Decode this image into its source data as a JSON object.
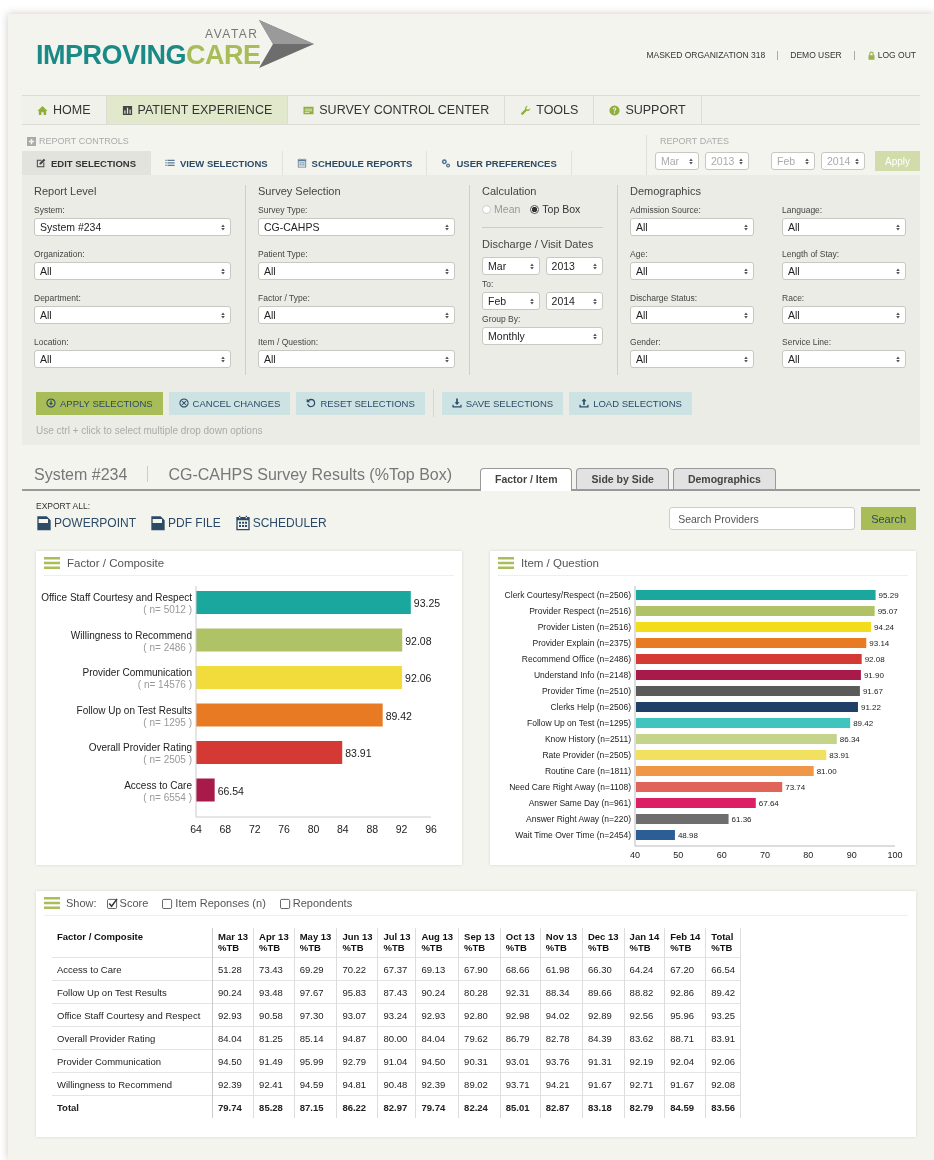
{
  "header": {
    "logo": {
      "small": "AVATAR",
      "main_1": "IMPROVING",
      "main_2": "CARE"
    },
    "top_links": [
      {
        "label": "MASKED ORGANIZATION 318",
        "kind": "text"
      },
      {
        "label": "DEMO USER",
        "kind": "text"
      },
      {
        "label": "LOG OUT",
        "kind": "logout"
      }
    ]
  },
  "nav": [
    {
      "label": "HOME",
      "kind": "home",
      "selected": false
    },
    {
      "label": "PATIENT EXPERIENCE",
      "kind": "chart",
      "selected": true
    },
    {
      "label": "SURVEY CONTROL CENTER",
      "kind": "card",
      "selected": false
    },
    {
      "label": "TOOLS",
      "kind": "wrench",
      "selected": false
    },
    {
      "label": "SUPPORT",
      "kind": "help",
      "selected": false
    }
  ],
  "report_controls": {
    "title": "REPORT CONTROLS",
    "tabs": [
      {
        "label": "EDIT SELECTIONS",
        "kind": "edit",
        "selected": true
      },
      {
        "label": "VIEW SELECTIONS",
        "kind": "list",
        "selected": false
      },
      {
        "label": "SCHEDULE REPORTS",
        "kind": "calendar",
        "selected": false
      },
      {
        "label": "USER PREFERENCES",
        "kind": "gears",
        "selected": false
      }
    ]
  },
  "report_dates": {
    "title": "REPORT DATES",
    "disabled": true,
    "fields": [
      "Mar",
      "2013",
      "Feb",
      "2014"
    ],
    "apply": "Apply"
  },
  "report_level": {
    "title": "Report Level",
    "fields": [
      {
        "label": "System:",
        "value": "System #234"
      },
      {
        "label": "Organization:",
        "value": "All"
      },
      {
        "label": "Department:",
        "value": "All"
      },
      {
        "label": "Location:",
        "value": "All"
      }
    ]
  },
  "survey_selection": {
    "title": "Survey Selection",
    "fields": [
      {
        "label": "Survey Type:",
        "value": "CG-CAHPS"
      },
      {
        "label": "Patient Type:",
        "value": "All"
      },
      {
        "label": "Factor / Type:",
        "value": "All"
      },
      {
        "label": "Item / Question:",
        "value": "All"
      }
    ]
  },
  "calculation": {
    "title": "Calculation",
    "options": [
      {
        "label": "Mean",
        "selected": false,
        "disabled": true
      },
      {
        "label": "Top Box",
        "selected": true,
        "disabled": false
      }
    ],
    "dates_title": "Discharge / Visit Dates",
    "from": [
      "Mar",
      "2013"
    ],
    "to_label": "To:",
    "to": [
      "Feb",
      "2014"
    ],
    "group_by": {
      "label": "Group By:",
      "value": "Monthly"
    }
  },
  "demographics": {
    "title": "Demographics",
    "fields": [
      {
        "label": "Admission Source:",
        "value": "All"
      },
      {
        "label": "Language:",
        "value": "All"
      },
      {
        "label": "Age:",
        "value": "All"
      },
      {
        "label": "Length of Stay:",
        "value": "All"
      },
      {
        "label": "Discharge Status:",
        "value": "All"
      },
      {
        "label": "Race:",
        "value": "All"
      },
      {
        "label": "Gender:",
        "value": "All"
      },
      {
        "label": "Service Line:",
        "value": "All"
      }
    ]
  },
  "actions": [
    {
      "label": "APPLY SELECTIONS",
      "kind": "apply"
    },
    {
      "label": "CANCEL CHANGES",
      "kind": "cancel"
    },
    {
      "label": "RESET SELECTIONS",
      "kind": "reset"
    },
    {
      "label": "SAVE SELECTIONS",
      "kind": "save"
    },
    {
      "label": "LOAD SELECTIONS",
      "kind": "load"
    }
  ],
  "hint": "Use ctrl + click to select multiple drop down options",
  "results": {
    "system": "System #234",
    "title": "CG-CAHPS Survey Results (%Top Box)",
    "tabs": [
      {
        "label": "Factor / Item",
        "selected": true
      },
      {
        "label": "Side by Side",
        "selected": false
      },
      {
        "label": "Demographics",
        "selected": false
      }
    ]
  },
  "export": {
    "title": "EXPORT ALL:",
    "items": [
      {
        "label": "POWERPOINT",
        "kind": "ppt"
      },
      {
        "label": "PDF FILE",
        "kind": "pdf"
      },
      {
        "label": "SCHEDULER",
        "kind": "calendar"
      }
    ]
  },
  "search": {
    "placeholder": "Search Providers",
    "button": "Search"
  },
  "factor_chart": {
    "title": "Factor / Composite",
    "bars": [
      {
        "count": "( n= 5012 )",
        "color": "#1aa89e"
      },
      {
        "count": "( n= 2486 )",
        "color": "#afc266"
      },
      {
        "count": "( n= 14576 )",
        "color": "#f2dc3c"
      },
      {
        "count": "( n= 1295 )",
        "color": "#e87a24"
      },
      {
        "count": "( n= 2505 )",
        "color": "#d43a33"
      },
      {
        "count": "( n= 6554 )",
        "color": "#a81a4a"
      }
    ],
    "chart_data": {
      "type": "bar",
      "orientation": "horizontal",
      "categories": [
        "Office Staff Courtesy and Respect",
        "Willingness to Recommend",
        "Provider Communication",
        "Follow Up on Test Results",
        "Overall Provider Rating",
        "Access to Care"
      ],
      "values": [
        93.25,
        92.08,
        92.06,
        89.42,
        83.91,
        66.54
      ],
      "xlim": [
        64,
        96
      ],
      "xticks": [
        64,
        68,
        72,
        76,
        80,
        84,
        88,
        92,
        96
      ],
      "data_labels": true
    }
  },
  "item_chart": {
    "title": "Item / Question",
    "bars": [
      {
        "color": "#1aa89e"
      },
      {
        "color": "#afc266"
      },
      {
        "color": "#f2dc1c"
      },
      {
        "color": "#e87a24"
      },
      {
        "color": "#d43a33"
      },
      {
        "color": "#a81a4a"
      },
      {
        "color": "#5a5a5a"
      },
      {
        "color": "#1f3f66"
      },
      {
        "color": "#3fc4be"
      },
      {
        "color": "#c4d48a"
      },
      {
        "color": "#f2e060"
      },
      {
        "color": "#f09648"
      },
      {
        "color": "#e0645a"
      },
      {
        "color": "#dc1e64"
      },
      {
        "color": "#6e6e6e"
      },
      {
        "color": "#2a5e94"
      }
    ],
    "chart_data": {
      "type": "bar",
      "orientation": "horizontal",
      "categories": [
        "Clerk Courtesy/Respect (n=2506)",
        "Provider Respect (n=2516)",
        "Provider Listen (n=2516)",
        "Provider Explain (n=2375)",
        "Recommend Office (n=2486)",
        "Understand Info (n=2148)",
        "Provider Time (n=2510)",
        "Clerks Help (n=2506)",
        "Follow Up on Test (n=1295)",
        "Know History (n=2511)",
        "Rate Provider (n=2505)",
        "Routine Care (n=1811)",
        "Need Care Right Away (n=1108)",
        "Answer Same Day (n=961)",
        "Answer Right Away (n=220)",
        "Wait Time Over Time (n=2454)"
      ],
      "values": [
        95.29,
        95.07,
        94.24,
        93.14,
        92.08,
        91.9,
        91.67,
        91.22,
        89.42,
        86.34,
        83.91,
        81.0,
        73.74,
        67.64,
        61.36,
        48.98
      ],
      "value_labels": [
        "95.29",
        "95.07",
        "94.24",
        "93.14",
        "92.08",
        "91.90",
        "91.67",
        "91.22",
        "89.42",
        "86.34",
        "83.91",
        "81.00",
        "73.74",
        "67.64",
        "61.36",
        "48.98"
      ],
      "xlim": [
        40,
        100
      ],
      "xticks": [
        40,
        50,
        60,
        70,
        80,
        90,
        100
      ]
    }
  },
  "table": {
    "show_label": "Show:",
    "options": [
      {
        "label": "Score",
        "checked": true
      },
      {
        "label": "Item Reponses (n)",
        "checked": false
      },
      {
        "label": "Repondents",
        "checked": false
      }
    ],
    "columns": [
      {
        "label": "Factor / Composite"
      },
      {
        "label": "Mar 13",
        "sub": "%TB"
      },
      {
        "label": "Apr 13",
        "sub": "%TB"
      },
      {
        "label": "May 13",
        "sub": "%TB"
      },
      {
        "label": "Jun 13",
        "sub": "%TB"
      },
      {
        "label": "Jul 13",
        "sub": "%TB"
      },
      {
        "label": "Aug 13",
        "sub": "%TB"
      },
      {
        "label": "Sep 13",
        "sub": "%TB"
      },
      {
        "label": "Oct 13",
        "sub": "%TB"
      },
      {
        "label": "Nov 13",
        "sub": "%TB"
      },
      {
        "label": "Dec 13",
        "sub": "%TB"
      },
      {
        "label": "Jan 14",
        "sub": "%TB"
      },
      {
        "label": "Feb 14",
        "sub": "%TB"
      },
      {
        "label": "Total",
        "sub": "%TB"
      }
    ],
    "rows": [
      {
        "total": false,
        "cells": [
          "Access to Care",
          "51.28",
          "73.43",
          "69.29",
          "70.22",
          "67.37",
          "69.13",
          "67.90",
          "68.66",
          "61.98",
          "66.30",
          "64.24",
          "67.20",
          "66.54"
        ]
      },
      {
        "total": false,
        "cells": [
          "Follow Up on Test Results",
          "90.24",
          "93.48",
          "97.67",
          "95.83",
          "87.43",
          "90.24",
          "80.28",
          "92.31",
          "88.34",
          "89.66",
          "88.82",
          "92.86",
          "89.42"
        ]
      },
      {
        "total": false,
        "cells": [
          "Office Staff Courtesy and Respect",
          "92.93",
          "90.58",
          "97.30",
          "93.07",
          "93.24",
          "92.93",
          "92.80",
          "92.98",
          "94.02",
          "92.89",
          "92.56",
          "95.96",
          "93.25"
        ]
      },
      {
        "total": false,
        "cells": [
          "Overall Provider Rating",
          "84.04",
          "81.25",
          "85.14",
          "94.87",
          "80.00",
          "84.04",
          "79.62",
          "86.79",
          "82.78",
          "84.39",
          "83.62",
          "88.71",
          "83.91"
        ]
      },
      {
        "total": false,
        "cells": [
          "Provider Communication",
          "94.50",
          "91.49",
          "95.99",
          "92.79",
          "91.04",
          "94.50",
          "90.31",
          "93.01",
          "93.76",
          "91.31",
          "92.19",
          "92.04",
          "92.06"
        ]
      },
      {
        "total": false,
        "cells": [
          "Willingness to Recommend",
          "92.39",
          "92.41",
          "94.59",
          "94.81",
          "90.48",
          "92.39",
          "89.02",
          "93.71",
          "94.21",
          "91.67",
          "92.71",
          "91.67",
          "92.08"
        ]
      },
      {
        "total": true,
        "cells": [
          "Total",
          "79.74",
          "85.28",
          "87.15",
          "86.22",
          "82.97",
          "79.74",
          "82.24",
          "85.01",
          "82.87",
          "83.18",
          "82.79",
          "84.59",
          "83.56"
        ]
      }
    ]
  }
}
